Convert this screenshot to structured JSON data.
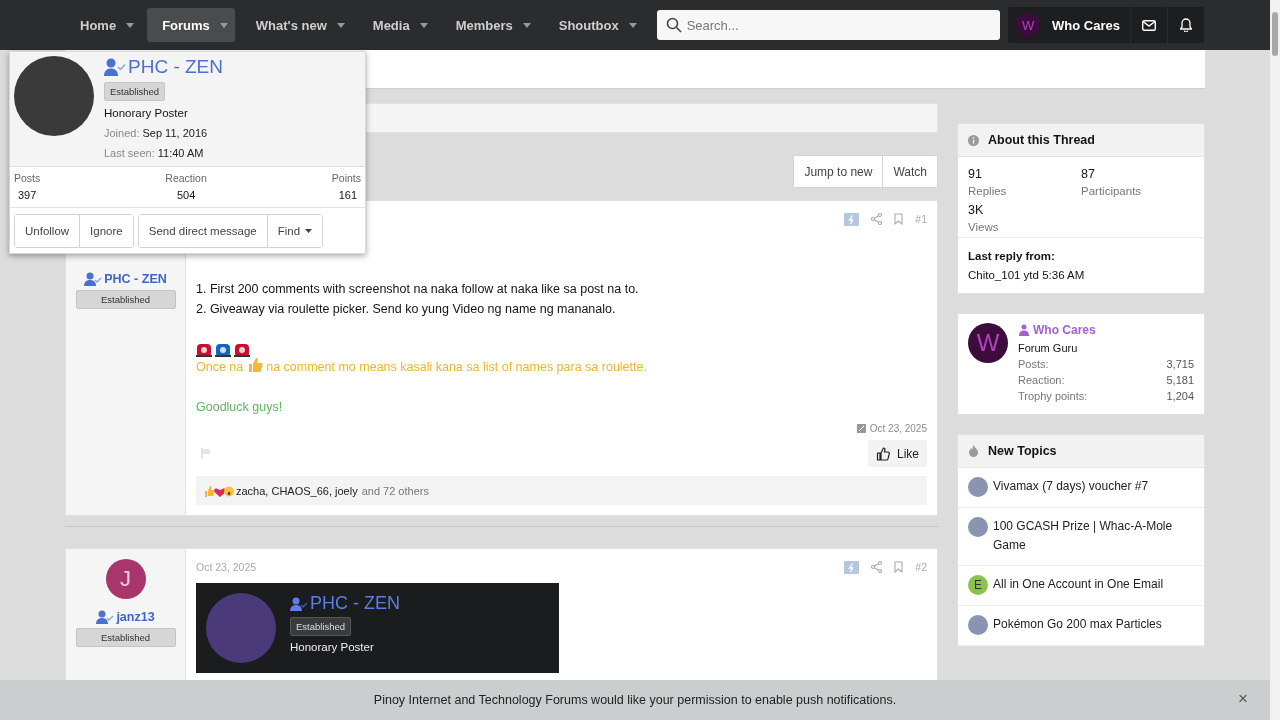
{
  "nav": {
    "items": [
      {
        "label": "Home",
        "selected": false
      },
      {
        "label": "Forums",
        "selected": true
      },
      {
        "label": "What's new",
        "selected": false
      },
      {
        "label": "Media",
        "selected": false
      },
      {
        "label": "Members",
        "selected": false
      },
      {
        "label": "Shoutbox",
        "selected": false
      }
    ],
    "search": {
      "placeholder": "Search..."
    },
    "user": {
      "initial": "W",
      "name": "Who Cares"
    }
  },
  "thread_actions": [
    "Jump to new",
    "Watch"
  ],
  "posts": [
    {
      "author": "PHC - ZEN",
      "badge": "Established",
      "number": "#1",
      "footer_date": "Oct 23, 2025",
      "content": [
        {
          "kind": "line",
          "text": "1. First 200 comments with screenshot na naka follow at naka like sa post na to."
        },
        {
          "kind": "line",
          "text": "2. Giveaway via roulette picker. Send ko yung Video ng name ng mananalo."
        },
        {
          "kind": "sirens"
        },
        {
          "kind": "thumb_line",
          "before": "Once na",
          "after": "na comment mo means kasali kana sa list of names para sa roulette.",
          "color": "#f0b429"
        },
        {
          "kind": "spacer"
        },
        {
          "kind": "line",
          "text": "Goodluck guys!",
          "color": "#5cb85c"
        }
      ],
      "like": "Like",
      "reactions": {
        "names": "zacha, CHAOS_66, joely",
        "others": "and 72 others"
      }
    },
    {
      "author": "janz13",
      "badge": "Established",
      "number": "#2",
      "date": "Oct 23, 2025",
      "avatar_initial": "J",
      "color": "#a8356b",
      "content": [
        {
          "kind": "screenshot",
          "name": "PHC - ZEN",
          "badge": "Established",
          "title": "Honorary Poster"
        }
      ]
    }
  ],
  "popup": {
    "name": "PHC - ZEN",
    "badge": "Established",
    "title": "Honorary Poster",
    "joined_label": "Joined:",
    "joined": "Sep 11, 2016",
    "last_seen_label": "Last seen:",
    "last_seen": "11:40 AM",
    "stats": [
      {
        "label": "Posts",
        "value": "397"
      },
      {
        "label": "Reaction",
        "value": "504"
      },
      {
        "label": "Points",
        "value": "161"
      }
    ],
    "button_groups": [
      [
        {
          "label": "Unfollow",
          "kind": "plain"
        },
        {
          "label": "Ignore",
          "kind": "plain"
        }
      ],
      [
        {
          "label": "Send direct message",
          "kind": "plain"
        },
        {
          "label": "Find",
          "kind": "menu"
        }
      ]
    ]
  },
  "sidebar": {
    "about": {
      "title": "About this Thread",
      "stats": [
        {
          "value": "91",
          "label": "Replies"
        },
        {
          "value": "87",
          "label": "Participants"
        },
        {
          "value": "3K",
          "label": "Views"
        }
      ],
      "last_reply_label": "Last reply from:",
      "last_reply": "Chito_101 ytd 5:36 AM"
    },
    "member": {
      "initial": "W",
      "name": "Who Cares",
      "title": "Forum Guru",
      "stats": [
        {
          "label": "Posts:",
          "value": "3,715"
        },
        {
          "label": "Reaction:",
          "value": "5,181"
        },
        {
          "label": "Trophy points:",
          "value": "1,204"
        }
      ]
    },
    "new_topics": {
      "title": "New Topics",
      "items": [
        {
          "title": "Vivamax (7 days) voucher #7"
        },
        {
          "title": "100 GCASH Prize | Whac-A-Mole Game"
        },
        {
          "title": "All in One Account in One Email",
          "initial": "E",
          "color": "#8bc34a"
        },
        {
          "title": "Pokémon Go 200 max Particles"
        }
      ]
    }
  },
  "notice": {
    "text": "Pinoy Internet and Technology Forums would like your permission to enable push notifications.",
    "close": "×"
  }
}
